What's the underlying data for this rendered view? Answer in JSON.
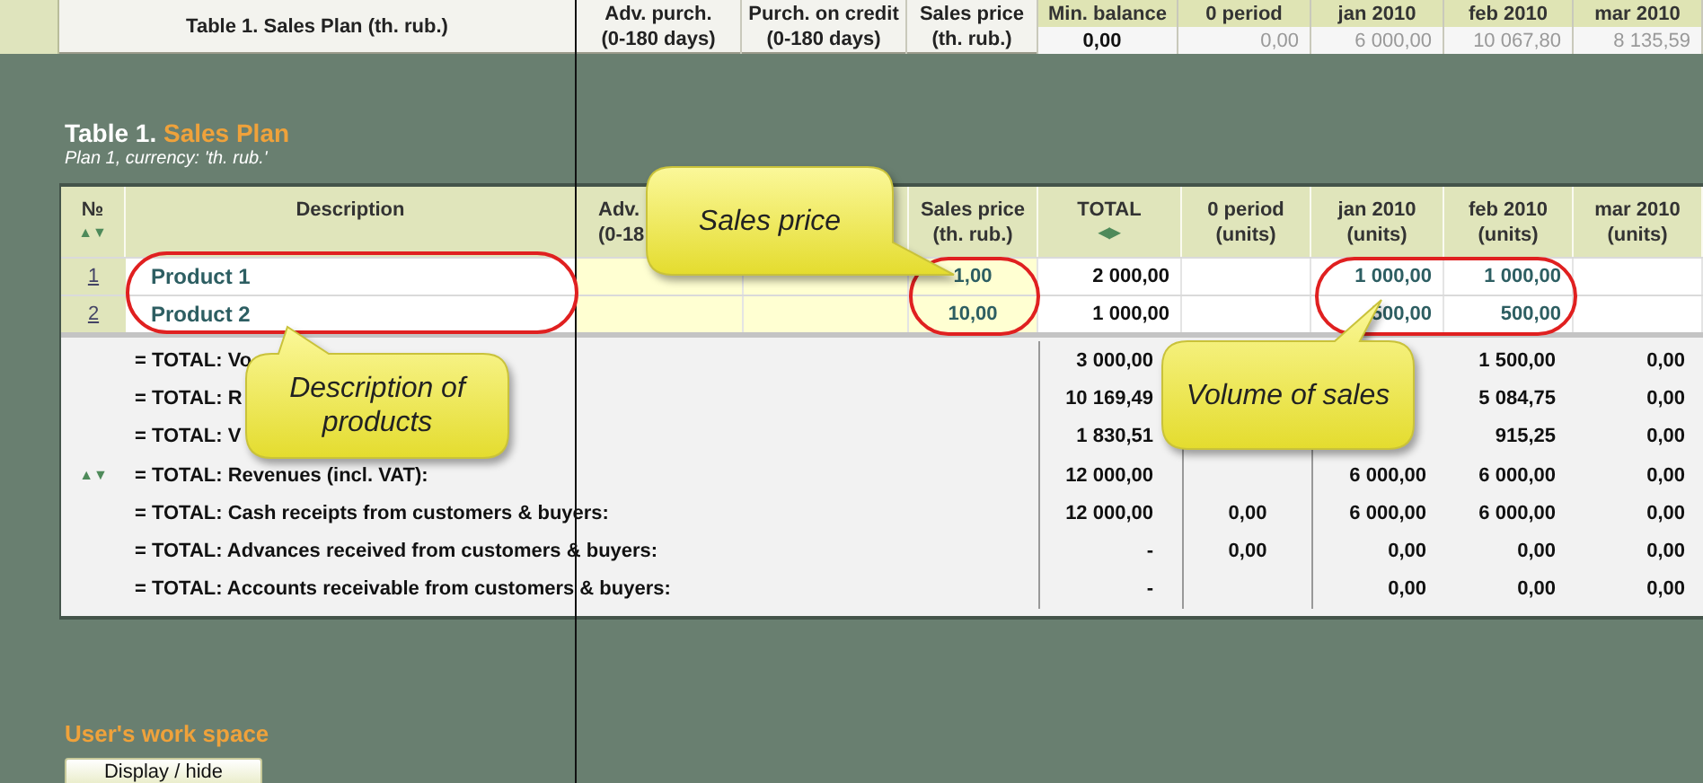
{
  "top_bar": {
    "title": "Table 1. Sales Plan (th. rub.)",
    "columns": [
      {
        "lines": [
          "Adv. purch.",
          "(0-180 days)"
        ]
      },
      {
        "lines": [
          "Purch. on credit",
          "(0-180 days)"
        ]
      },
      {
        "lines": [
          "Sales price",
          "(th. rub.)"
        ]
      }
    ],
    "summary": [
      {
        "label": "Min. balance",
        "value": "0,00",
        "kind": "bold"
      },
      {
        "label": "0 period",
        "value": "0,00",
        "kind": "muted"
      },
      {
        "label": "jan 2010",
        "value": "6 000,00",
        "kind": "muted"
      },
      {
        "label": "feb 2010",
        "value": "10 067,80",
        "kind": "muted"
      },
      {
        "label": "mar 2010",
        "value": "8 135,59",
        "kind": "muted"
      }
    ]
  },
  "table": {
    "title_prefix": "Table 1.",
    "title": "Sales Plan",
    "subtitle": "Plan 1, currency: 'th. rub.'",
    "columns": [
      {
        "lines": [
          "№"
        ],
        "sorter": "▲▼"
      },
      {
        "lines": [
          "Description"
        ]
      },
      {
        "lines": [
          "Adv.",
          "(0-18"
        ]
      },
      {
        "lines": [
          "Sales price",
          "(th. rub.)"
        ]
      },
      {
        "lines": [
          "TOTAL"
        ],
        "sorter": "◀▶"
      },
      {
        "lines": [
          "0 period",
          "(units)"
        ]
      },
      {
        "lines": [
          "jan 2010",
          "(units)"
        ]
      },
      {
        "lines": [
          "feb 2010",
          "(units)"
        ]
      },
      {
        "lines": [
          "mar 2010",
          "(units)"
        ]
      }
    ],
    "products": [
      {
        "number": "1",
        "description": "Product 1",
        "cells": [
          null,
          null,
          "1,00",
          "2 000,00",
          null,
          "1 000,00",
          "1 000,00",
          null
        ]
      },
      {
        "number": "2",
        "description": "Product 2",
        "cells": [
          null,
          null,
          "10,00",
          "1 000,00",
          null,
          "500,00",
          "500,00",
          null
        ]
      }
    ],
    "totals": [
      {
        "label": "= TOTAL: Vo",
        "cells": [
          "3 000,00",
          null,
          null,
          "1 500,00",
          "0,00"
        ]
      },
      {
        "label": "= TOTAL: R",
        "cells": [
          "10 169,49",
          null,
          null,
          "5 084,75",
          "0,00"
        ]
      },
      {
        "label": "= TOTAL: V",
        "cells": [
          "1 830,51",
          null,
          null,
          "915,25",
          "0,00"
        ]
      },
      {
        "label": "= TOTAL: Revenues (incl. VAT):",
        "marker": "▲▼",
        "cells": [
          "12 000,00",
          null,
          "6 000,00",
          "6 000,00",
          "0,00"
        ]
      },
      {
        "label": "= TOTAL: Cash receipts from customers & buyers:",
        "cells": [
          "12 000,00",
          "0,00",
          "6 000,00",
          "6 000,00",
          "0,00"
        ]
      },
      {
        "label": "= TOTAL: Advances received from customers & buyers:",
        "cells": [
          "-",
          "0,00",
          "0,00",
          "0,00",
          "0,00"
        ]
      },
      {
        "label": "= TOTAL: Accounts receivable from customers & buyers:",
        "cells": [
          "-",
          null,
          "0,00",
          "0,00",
          "0,00"
        ]
      }
    ]
  },
  "callouts": [
    {
      "text": "Sales price"
    },
    {
      "text": "Description of products"
    },
    {
      "text": "Volume of sales"
    }
  ],
  "workspace": {
    "title": "User's work space",
    "button": "Display / hide"
  }
}
